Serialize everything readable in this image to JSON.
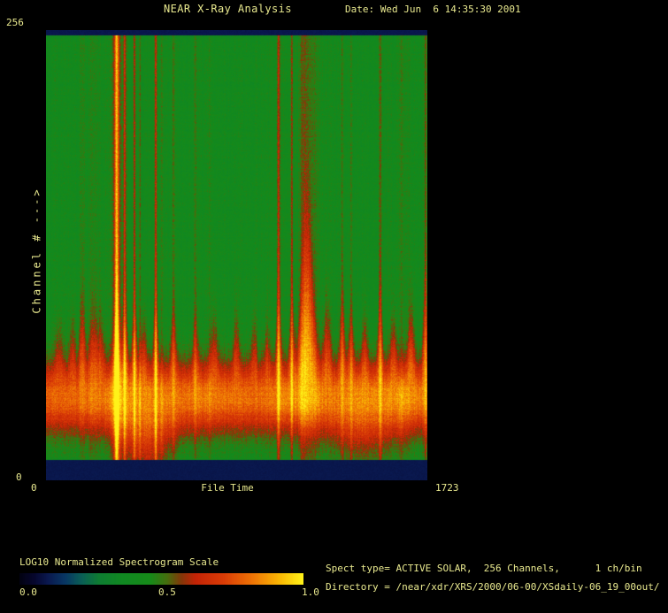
{
  "window": {
    "background": "#000000",
    "text_color": "#e9e98f"
  },
  "header": {
    "title": "NEAR X-Ray Analysis",
    "date_label": "Date: Wed Jun  6 14:35:30 2001"
  },
  "y_axis": {
    "label": "Channel # --->",
    "max_tick": "256",
    "min_tick": "0"
  },
  "x_axis": {
    "label": "File Time",
    "min_tick": "0",
    "max_tick": "1723"
  },
  "colorbar": {
    "title": "LOG10 Normalized Spectrogram Scale",
    "ticks": [
      "0.0",
      "0.5",
      "1.0"
    ]
  },
  "info": {
    "line1": "Spect type= ACTIVE SOLAR,  256 Channels,      1 ch/bin",
    "line2": "Directory = /near/xdr/XRS/2000/06-00/XSdaily-06_19_00out/"
  },
  "chart_data": {
    "type": "heatmap",
    "title": "NEAR X-Ray Analysis",
    "xlabel": "File Time",
    "ylabel": "Channel #",
    "xlim": [
      0,
      1723
    ],
    "ylim": [
      0,
      256
    ],
    "scale": {
      "label": "LOG10 Normalized Spectrogram Scale",
      "range": [
        0.0,
        1.0
      ]
    },
    "legend_position": "bottom-left",
    "grid": false,
    "colormap": {
      "name": "idl-std-gamma-ii",
      "stops": [
        [
          0.0,
          2,
          2,
          18
        ],
        [
          0.05,
          6,
          6,
          45
        ],
        [
          0.1,
          10,
          25,
          80
        ],
        [
          0.16,
          8,
          55,
          100
        ],
        [
          0.22,
          10,
          95,
          85
        ],
        [
          0.28,
          14,
          125,
          50
        ],
        [
          0.36,
          16,
          136,
          34
        ],
        [
          0.46,
          22,
          138,
          25
        ],
        [
          0.52,
          70,
          110,
          14
        ],
        [
          0.57,
          130,
          55,
          8
        ],
        [
          0.62,
          195,
          35,
          6
        ],
        [
          0.72,
          218,
          60,
          6
        ],
        [
          0.82,
          238,
          115,
          5
        ],
        [
          0.92,
          250,
          185,
          4
        ],
        [
          1.0,
          255,
          242,
          25
        ]
      ]
    },
    "background_level": 0.42,
    "noise": 0.1,
    "gap_level": 0.095,
    "gaps": {
      "top_start_channel": 253,
      "bottom_end_channel": 11.5
    },
    "band": {
      "center_channel": 47,
      "sigma_above": 18,
      "sigma_below": 14,
      "amplitude": 0.37,
      "bright_spots": [
        {
          "t": 420,
          "amp": 0.07,
          "w": 110
        },
        {
          "t": 760,
          "amp": 0.04,
          "w": 120
        },
        {
          "t": 1140,
          "amp": 0.07,
          "w": 90
        },
        {
          "t": 1430,
          "amp": 0.08,
          "w": 90
        },
        {
          "t": 1640,
          "amp": 0.06,
          "w": 80
        }
      ],
      "low_bulges": [
        {
          "t": 450,
          "amp": 0.8,
          "w": 80
        },
        {
          "t": 1430,
          "amp": 0.4,
          "w": 100
        }
      ],
      "spikes": [
        {
          "t": 60,
          "amp": 0.25,
          "w": 12
        },
        {
          "t": 120,
          "amp": 0.3,
          "w": 10
        },
        {
          "t": 164,
          "amp": 0.45,
          "w": 10
        },
        {
          "t": 216,
          "amp": 0.35,
          "w": 16
        },
        {
          "t": 250,
          "amp": 0.3,
          "w": 9
        },
        {
          "t": 320,
          "amp": 0.55,
          "w": 10
        },
        {
          "t": 356,
          "amp": 0.5,
          "w": 8
        },
        {
          "t": 400,
          "amp": 0.45,
          "w": 8
        },
        {
          "t": 440,
          "amp": 0.3,
          "w": 10
        },
        {
          "t": 496,
          "amp": 0.5,
          "w": 8
        },
        {
          "t": 576,
          "amp": 0.35,
          "w": 9
        },
        {
          "t": 675,
          "amp": 0.3,
          "w": 9
        },
        {
          "t": 760,
          "amp": 0.3,
          "w": 12
        },
        {
          "t": 860,
          "amp": 0.35,
          "w": 9
        },
        {
          "t": 940,
          "amp": 0.3,
          "w": 9
        },
        {
          "t": 1000,
          "amp": 0.25,
          "w": 9
        },
        {
          "t": 1051,
          "amp": 0.55,
          "w": 8
        },
        {
          "t": 1111,
          "amp": 0.45,
          "w": 8
        },
        {
          "t": 1180,
          "amp": 1.25,
          "w": 22
        },
        {
          "t": 1270,
          "amp": 0.45,
          "w": 12
        },
        {
          "t": 1339,
          "amp": 0.5,
          "w": 9
        },
        {
          "t": 1379,
          "amp": 0.35,
          "w": 9
        },
        {
          "t": 1440,
          "amp": 0.3,
          "w": 10
        },
        {
          "t": 1510,
          "amp": 0.5,
          "w": 8
        },
        {
          "t": 1570,
          "amp": 0.35,
          "w": 9
        },
        {
          "t": 1650,
          "amp": 0.45,
          "w": 10
        },
        {
          "t": 1714,
          "amp": 0.6,
          "w": 8
        }
      ]
    },
    "streaks": [
      {
        "t": 164,
        "amp": 0.05,
        "w": 8
      },
      {
        "t": 216,
        "amp": 0.05,
        "w": 18
      },
      {
        "t": 320,
        "amp": 0.42,
        "w": 7
      },
      {
        "t": 320,
        "amp": 0.1,
        "w": 26
      },
      {
        "t": 356,
        "amp": 0.2,
        "w": 4
      },
      {
        "t": 400,
        "amp": 0.2,
        "w": 4
      },
      {
        "t": 424,
        "amp": 0.1,
        "w": 3
      },
      {
        "t": 496,
        "amp": 0.22,
        "w": 4
      },
      {
        "t": 524,
        "amp": 0.06,
        "w": 4
      },
      {
        "t": 576,
        "amp": 0.11,
        "w": 4
      },
      {
        "t": 675,
        "amp": 0.08,
        "w": 4
      },
      {
        "t": 739,
        "amp": 0.06,
        "w": 4
      },
      {
        "t": 1051,
        "amp": 0.22,
        "w": 5
      },
      {
        "t": 1111,
        "amp": 0.18,
        "w": 4
      },
      {
        "t": 1163,
        "amp": 0.09,
        "w": 14
      },
      {
        "t": 1199,
        "amp": 0.07,
        "w": 30
      },
      {
        "t": 1339,
        "amp": 0.08,
        "w": 4
      },
      {
        "t": 1379,
        "amp": 0.07,
        "w": 4
      },
      {
        "t": 1510,
        "amp": 0.12,
        "w": 4
      },
      {
        "t": 1610,
        "amp": 0.05,
        "w": 18
      },
      {
        "t": 1714,
        "amp": 0.13,
        "w": 4
      }
    ]
  }
}
